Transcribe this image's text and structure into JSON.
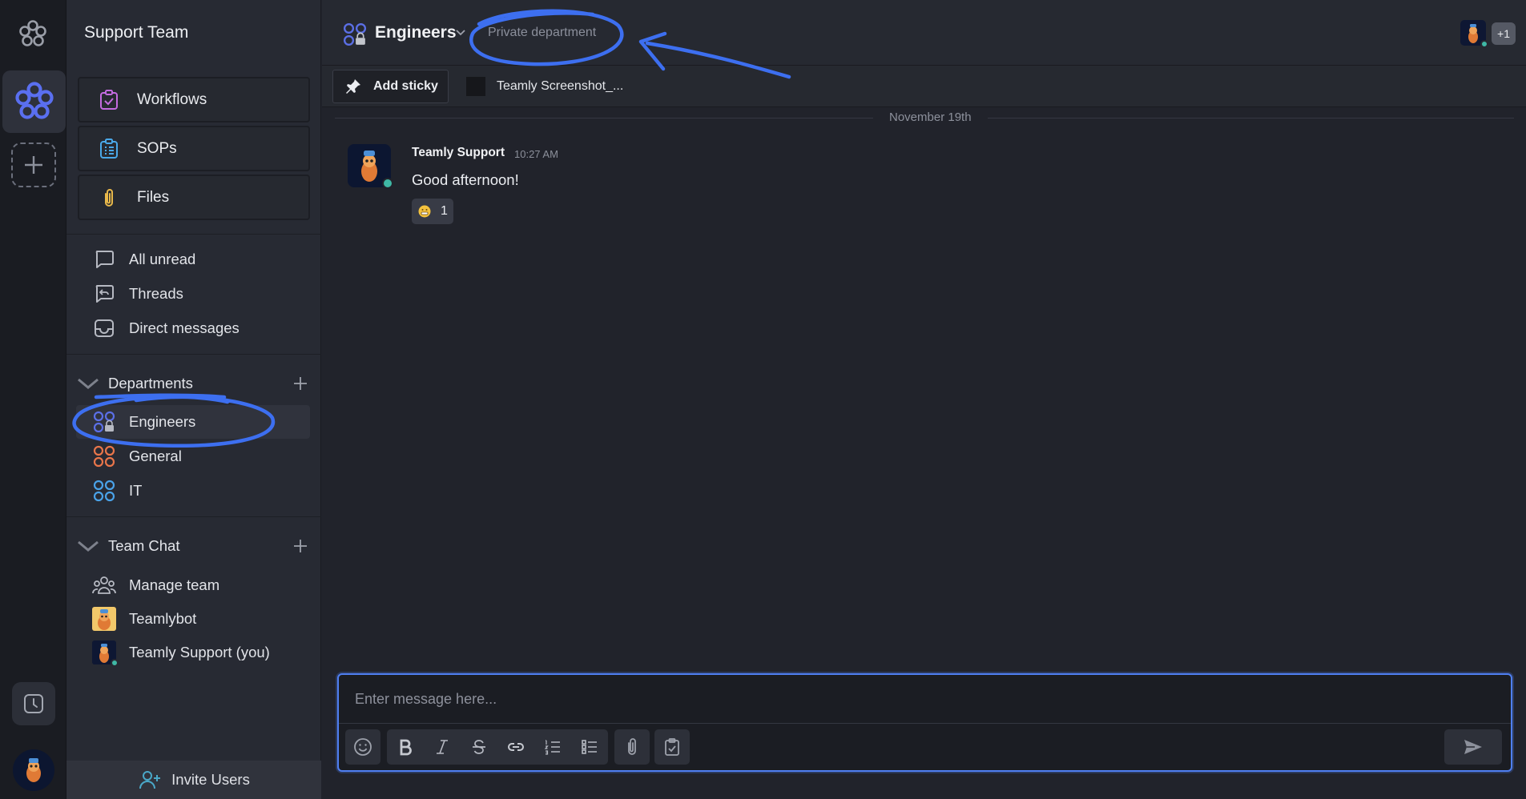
{
  "sidebar": {
    "team_name": "Support Team",
    "cards": [
      {
        "label": "Workflows",
        "icon": "workflows-icon"
      },
      {
        "label": "SOPs",
        "icon": "sops-icon"
      },
      {
        "label": "Files",
        "icon": "paperclip-icon"
      }
    ],
    "nav": [
      {
        "label": "All unread",
        "icon": "chat-bubble-icon"
      },
      {
        "label": "Threads",
        "icon": "threads-icon"
      },
      {
        "label": "Direct messages",
        "icon": "inbox-icon"
      }
    ],
    "departments": {
      "title": "Departments",
      "items": [
        {
          "label": "Engineers",
          "color": "#5b6fe6",
          "private": true
        },
        {
          "label": "General",
          "color": "#e8754a",
          "private": false
        },
        {
          "label": "IT",
          "color": "#4aa2e8",
          "private": false
        }
      ]
    },
    "team_chat": {
      "title": "Team Chat",
      "items": [
        {
          "label": "Manage team",
          "icon": "people-icon"
        },
        {
          "label": "Teamlybot",
          "icon": "teamlybot-avatar"
        },
        {
          "label": "Teamly Support (you)",
          "icon": "support-avatar"
        }
      ]
    },
    "invite_label": "Invite Users"
  },
  "header": {
    "channel_name": "Engineers",
    "channel_description": "Private department",
    "extra_members": "+1"
  },
  "sticky_bar": {
    "add_sticky_label": "Add sticky",
    "file_name": "Teamly Screenshot_..."
  },
  "messages": {
    "date_divider": "November 19th",
    "items": [
      {
        "author": "Teamly Support",
        "time": "10:27 AM",
        "text": "Good afternoon!",
        "reaction_count": "1"
      }
    ]
  },
  "composer": {
    "placeholder": "Enter message here..."
  },
  "colors": {
    "accent": "#4f7ff2",
    "online": "#3fb8a6",
    "annotation": "#3d6ff0"
  }
}
